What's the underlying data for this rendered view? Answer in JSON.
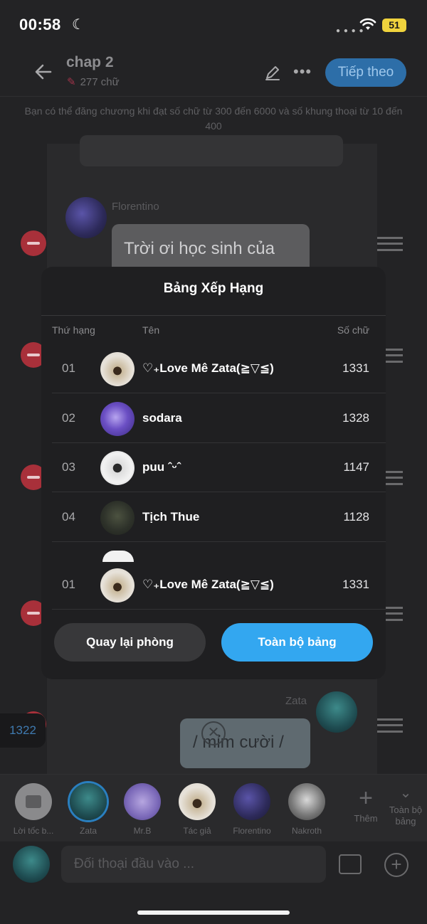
{
  "status_bar": {
    "time": "00:58",
    "battery": "51"
  },
  "header": {
    "title": "chap 2",
    "word_count": "277 chữ",
    "next_label": "Tiếp theo"
  },
  "notice": "Bạn có thể đăng chương khi đạt số chữ từ 300 đến 6000 và số khung thoại từ 10 đến 400",
  "chat": {
    "florentino_name": "Florentino",
    "florentino_message": "Trời ơi học sinh của",
    "zata_name": "Zata",
    "zata_message": "/ mỉm cười /",
    "count_badge": "1322"
  },
  "leaderboard": {
    "title": "Bảng Xếp Hạng",
    "columns": {
      "rank": "Thứ hạng",
      "name": "Tên",
      "count": "Số chữ"
    },
    "rows": [
      {
        "rank": "01",
        "name": "♡₊Love Mê Zata(≧▽≦)",
        "count": "1331"
      },
      {
        "rank": "02",
        "name": "sodara",
        "count": "1328"
      },
      {
        "rank": "03",
        "name": "puu ˆᵕˆ",
        "count": "1147"
      },
      {
        "rank": "04",
        "name": "Tịch Thue",
        "count": "1128"
      },
      {
        "rank": "01",
        "name": "♡₊Love Mê Zata(≧▽≦)",
        "count": "1331"
      }
    ],
    "back_label": "Quay lại phòng",
    "full_label": "Toàn bộ bảng"
  },
  "characters": {
    "items": [
      {
        "label": "Lời tốc b..."
      },
      {
        "label": "Zata"
      },
      {
        "label": "Mr.B"
      },
      {
        "label": "Tác giả"
      },
      {
        "label": "Florentino"
      },
      {
        "label": "Nakroth"
      }
    ],
    "add_label": "Thêm",
    "all_label": "Toàn bộ bảng"
  },
  "composer": {
    "placeholder": "Đối thoại đầu vào ..."
  }
}
